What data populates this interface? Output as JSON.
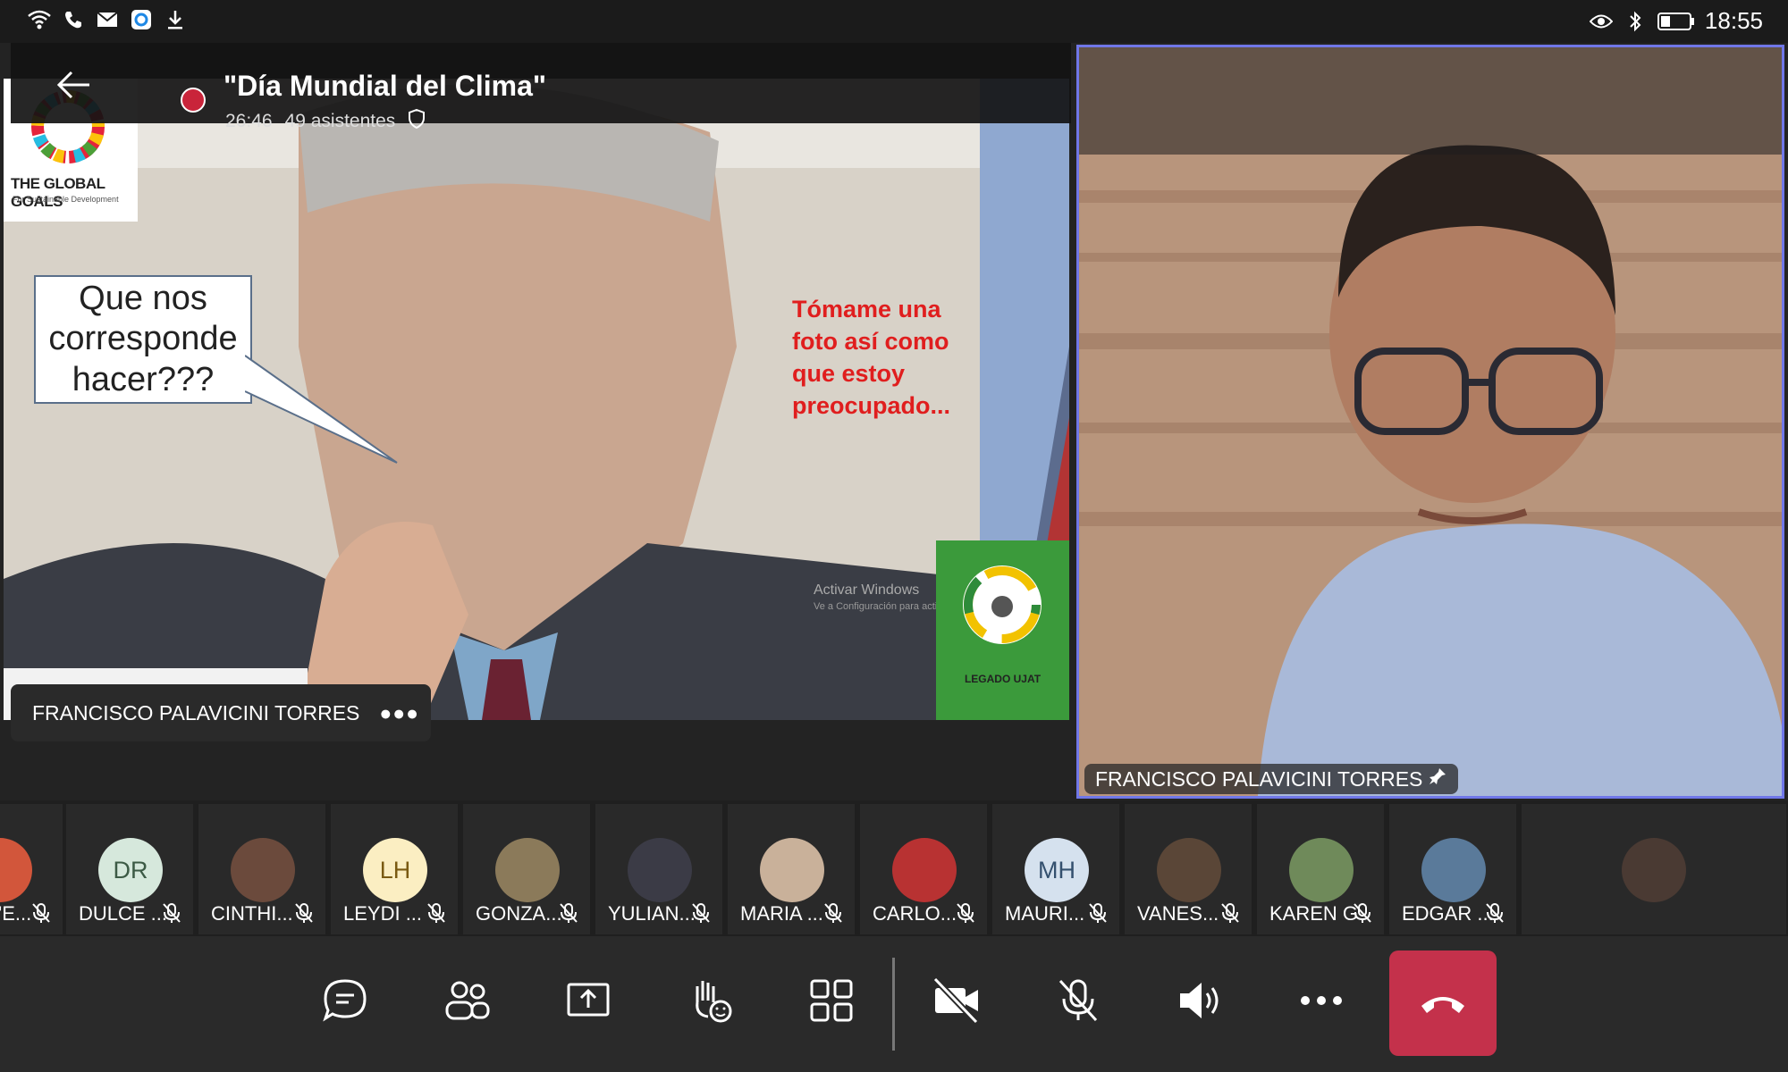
{
  "statusbar": {
    "time": "18:55"
  },
  "meeting": {
    "title": "\"Día Mundial del Clima\"",
    "elapsed": "26:46",
    "attendees": "49 asistentes"
  },
  "slide": {
    "logo_title": "THE GLOBAL GOALS",
    "logo_subtitle": "For Sustainable Development",
    "bubble_text": "Que nos corresponde hacer???",
    "red_text": "Tómame una foto así como que estoy preocupado...",
    "watermark_title": "Activar Windows",
    "watermark_sub": "Ve a Configuración para activar Windows.",
    "badge_text": "LEGADO UJAT"
  },
  "presenter": {
    "name": "FRANCISCO PALAVICINI TORRES"
  },
  "video": {
    "name": "FRANCISCO PALAVICINI TORRES"
  },
  "participants": [
    {
      "label": "'E...",
      "initials": "",
      "bg": "#d2563b"
    },
    {
      "label": "DULCE ...",
      "initials": "DR",
      "bg": "#d6e8dc",
      "fg": "#3c5a45"
    },
    {
      "label": "CINTHI...",
      "initials": "",
      "bg": "#6b4a3c"
    },
    {
      "label": "LEYDI ...",
      "initials": "LH",
      "bg": "#fbeec2",
      "fg": "#7a5a12"
    },
    {
      "label": "GONZA...",
      "initials": "",
      "bg": "#8b7a5a"
    },
    {
      "label": "YULIAN...",
      "initials": "",
      "bg": "#3b3b46"
    },
    {
      "label": "MARIA ...",
      "initials": "",
      "bg": "#c9b19a"
    },
    {
      "label": "CARLO...",
      "initials": "",
      "bg": "#b83232"
    },
    {
      "label": "MAURI...",
      "initials": "MH",
      "bg": "#d5e1ee",
      "fg": "#34506e"
    },
    {
      "label": "VANES...",
      "initials": "",
      "bg": "#5a4637"
    },
    {
      "label": "KAREN G",
      "initials": "",
      "bg": "#6f8a5a"
    },
    {
      "label": "EDGAR ...",
      "initials": "",
      "bg": "#5a7a9a"
    },
    {
      "label": "",
      "initials": "",
      "bg": "#4a3a33"
    }
  ]
}
